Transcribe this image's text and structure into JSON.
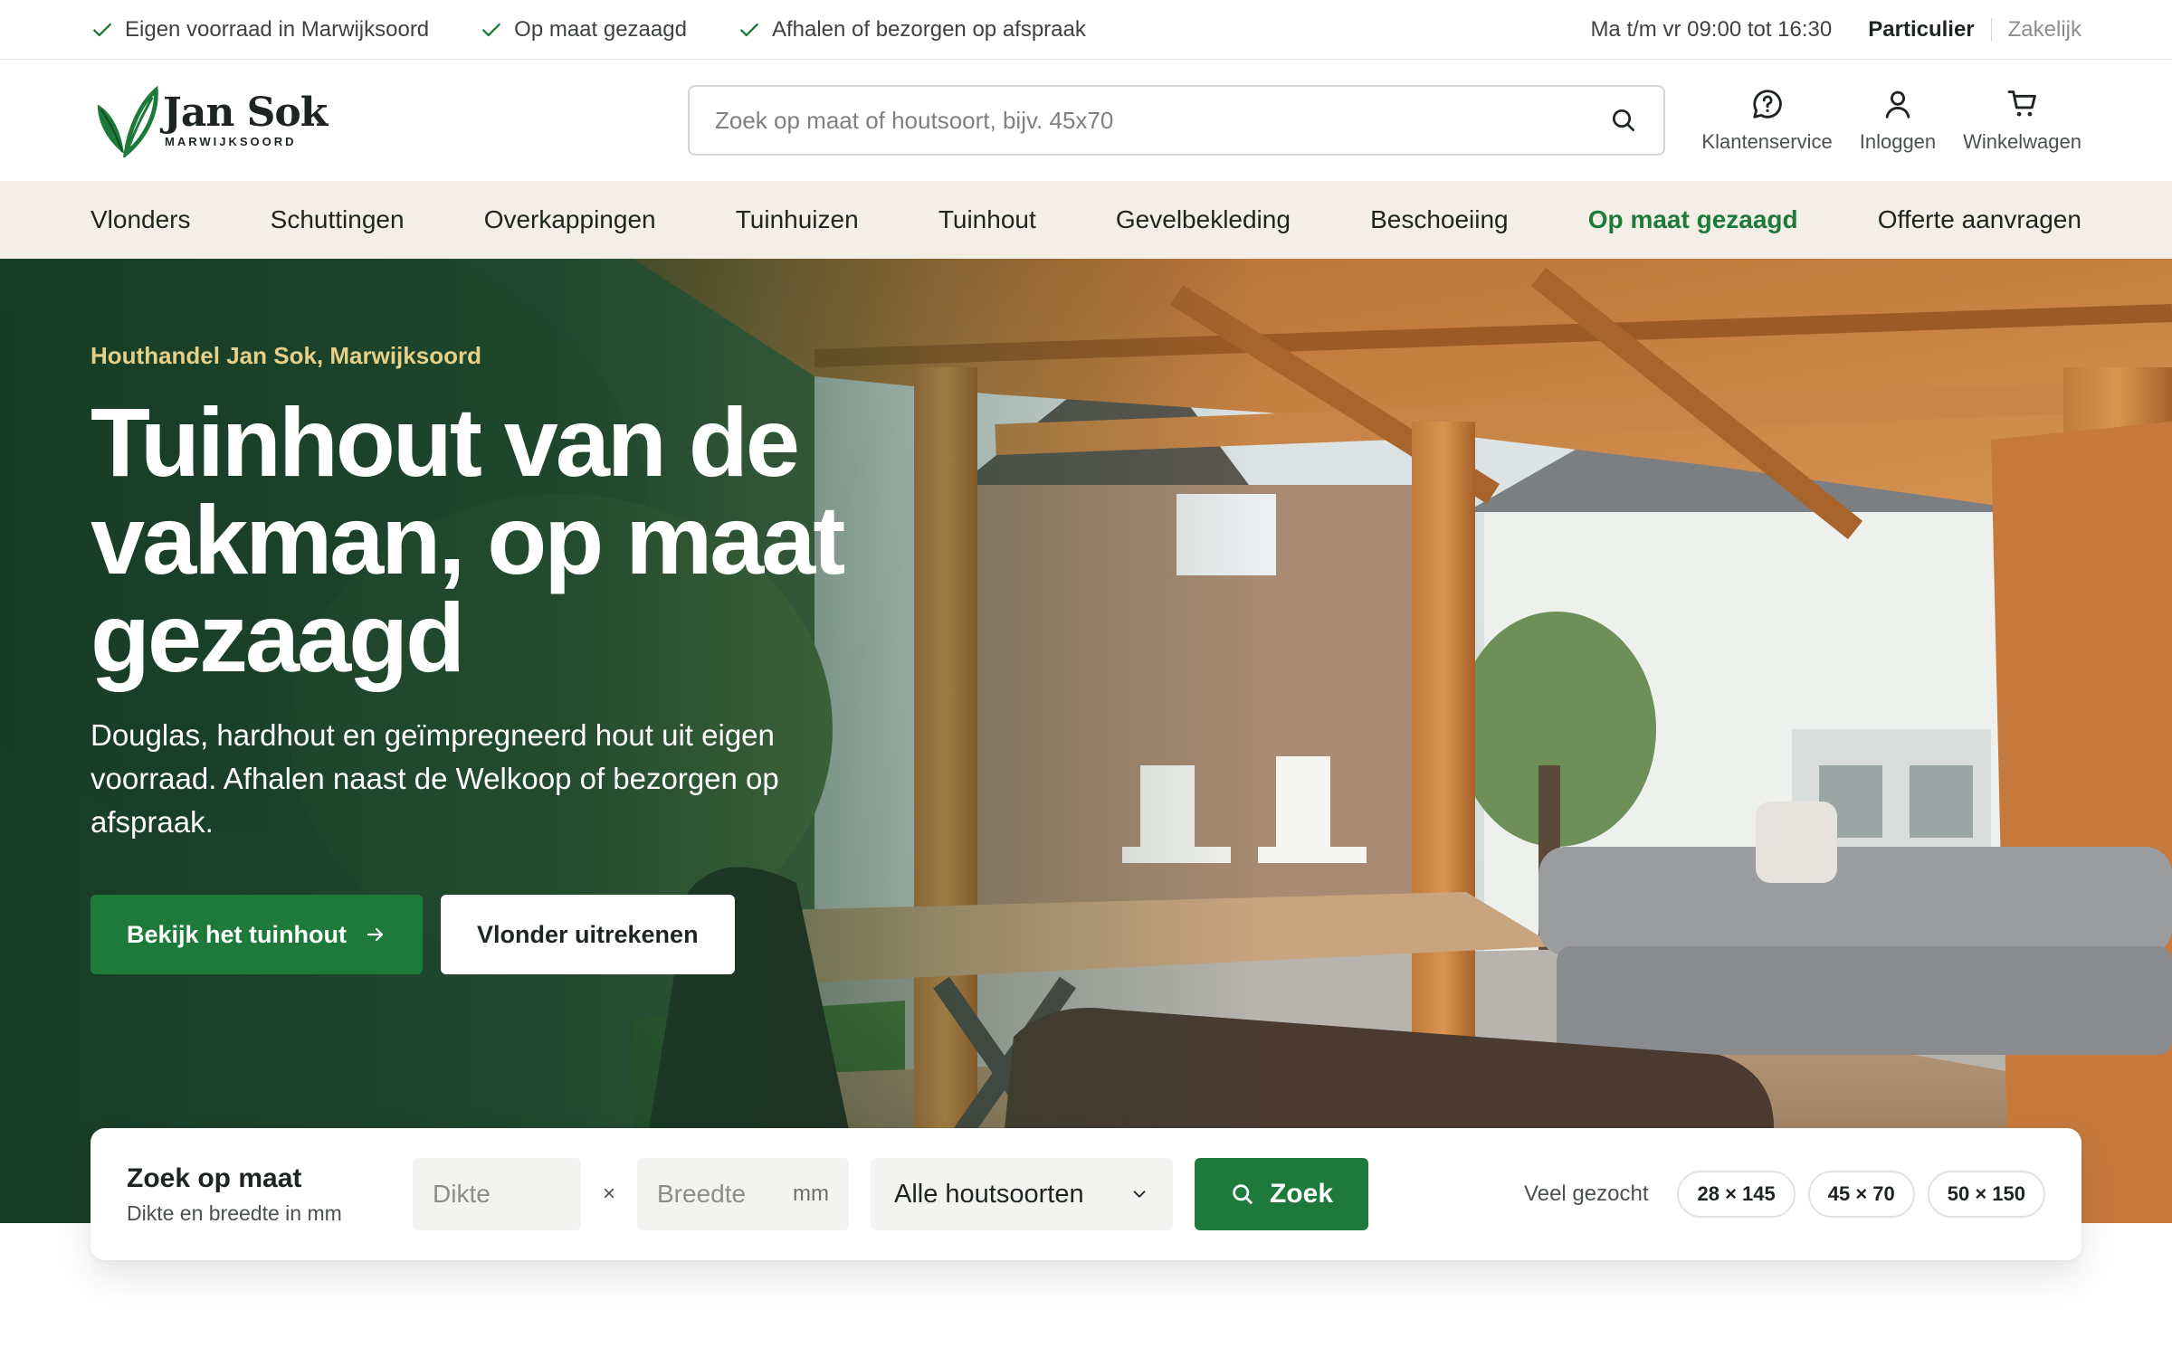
{
  "topbar": {
    "usps": [
      "Eigen voorraad in Marwijksoord",
      "Op maat gezaagd",
      "Afhalen of bezorgen op afspraak"
    ],
    "hours": "Ma t/m vr 09:00 tot 16:30",
    "segment_active": "Particulier",
    "segment_inactive": "Zakelijk"
  },
  "header": {
    "logo_name": "Jan Sok",
    "logo_sub": "MARWIJKSOORD",
    "search_placeholder": "Zoek op maat of houtsoort, bijv. 45x70",
    "actions": [
      {
        "label": "Klantenservice",
        "icon": "help-bubble-icon"
      },
      {
        "label": "Inloggen",
        "icon": "user-icon"
      },
      {
        "label": "Winkelwagen",
        "icon": "cart-icon"
      }
    ]
  },
  "nav": {
    "items": [
      "Vlonders",
      "Schuttingen",
      "Overkappingen",
      "Tuinhuizen",
      "Tuinhout",
      "Gevelbekleding",
      "Beschoeiing",
      "Op maat gezaagd",
      "Offerte aanvragen"
    ],
    "active": "Op maat gezaagd"
  },
  "hero": {
    "eyebrow": "Houthandel Jan Sok, Marwijksoord",
    "title": "Tuinhout van de vakman, op maat gezaagd",
    "text": "Douglas, hardhout en geïmpregneerd hout uit eigen voorraad. Afhalen naast de Welkoop of bezorgen op afspraak.",
    "primary_cta": "Bekijk het tuinhout",
    "secondary_cta": "Vlonder uitrekenen"
  },
  "finder": {
    "title": "Zoek op maat",
    "subtitle": "Dikte en breedte in mm",
    "thickness_placeholder": "Dikte",
    "times": "×",
    "width_placeholder": "Breedte",
    "unit": "mm",
    "select_value": "Alle houtsoorten",
    "button": "Zoek",
    "popular_label": "Veel gezocht",
    "chips": [
      "28 × 145",
      "45 × 70",
      "50 × 150"
    ]
  },
  "colors": {
    "brand_green": "#1d7a3b",
    "eyebrow_gold": "#e6cf86",
    "nav_background": "#f3efe6"
  }
}
